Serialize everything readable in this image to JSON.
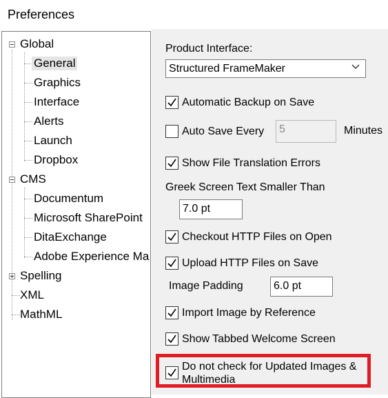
{
  "window": {
    "title": "Preferences"
  },
  "tree": {
    "items": [
      {
        "label": "Global",
        "level": 0,
        "expander": "minus"
      },
      {
        "label": "General",
        "level": 1,
        "selected": true
      },
      {
        "label": "Graphics",
        "level": 1
      },
      {
        "label": "Interface",
        "level": 1
      },
      {
        "label": "Alerts",
        "level": 1
      },
      {
        "label": "Launch",
        "level": 1
      },
      {
        "label": "Dropbox",
        "level": 1
      },
      {
        "label": "CMS",
        "level": 0,
        "expander": "minus"
      },
      {
        "label": "Documentum",
        "level": 1
      },
      {
        "label": "Microsoft SharePoint",
        "level": 1
      },
      {
        "label": "DitaExchange",
        "level": 1
      },
      {
        "label": "Adobe Experience Ma",
        "level": 1
      },
      {
        "label": "Spelling",
        "level": 0,
        "expander": "plus"
      },
      {
        "label": "XML",
        "level": 0
      },
      {
        "label": "MathML",
        "level": 0
      }
    ]
  },
  "general": {
    "product_interface_label": "Product Interface:",
    "product_interface_value": "Structured FrameMaker",
    "automatic_backup": {
      "label": "Automatic Backup on Save",
      "checked": true
    },
    "auto_save": {
      "label": "Auto Save Every",
      "checked": false,
      "value": "5",
      "unit": "Minutes"
    },
    "show_translation_errors": {
      "label": "Show File Translation Errors",
      "checked": true
    },
    "greek_label": "Greek Screen Text Smaller Than",
    "greek_value": "7.0 pt",
    "checkout_http": {
      "label": "Checkout HTTP Files on Open",
      "checked": true
    },
    "upload_http": {
      "label": "Upload HTTP Files on Save",
      "checked": true
    },
    "image_padding_label": "Image Padding",
    "image_padding_value": "6.0 pt",
    "import_by_reference": {
      "label": "Import Image by Reference",
      "checked": true
    },
    "tabbed_welcome": {
      "label": "Show Tabbed Welcome Screen",
      "checked": true
    },
    "no_check_updates": {
      "label": "Do not check for Updated Images & Multimedia",
      "checked": true
    }
  },
  "colors": {
    "highlight": "#e01c24",
    "panel_bg": "#f0f0f0"
  }
}
